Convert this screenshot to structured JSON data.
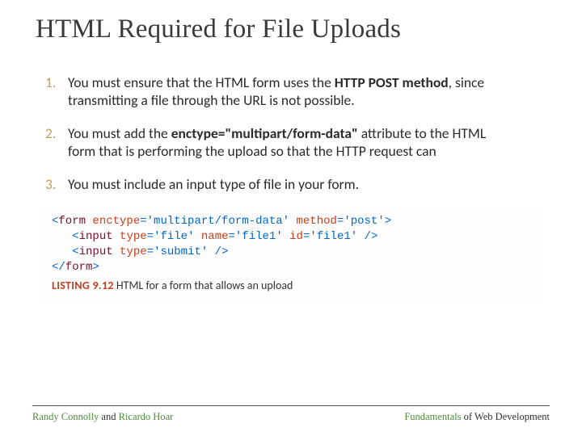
{
  "title": "HTML Required for File Uploads",
  "points": {
    "p1_a": "You must ensure that the HTML form uses the ",
    "p1_b": "HTTP POST method",
    "p1_c": ", since transmitting a file through the URL is not possible.",
    "p2_a": "You must add the ",
    "p2_b": "enctype=\"multipart/form-data\"",
    "p2_c": " attribute to the HTML form that is performing the upload so that the HTTP request can",
    "p3": "You must include an input type of file in your form."
  },
  "code": {
    "l1_open": "<",
    "l1_tag": "form",
    "l1_sp": " ",
    "l1_a1n": "enctype",
    "l1_eq": "=",
    "l1_a1v": "'multipart/form-data'",
    "l1_a2n": "method",
    "l1_a2v": "'post'",
    "l1_close": ">",
    "l2_indent": "   ",
    "l2_open": "<",
    "l2_tag": "input",
    "l2_a1n": "type",
    "l2_a1v": "'file'",
    "l2_a2n": "name",
    "l2_a2v": "'file1'",
    "l2_a3n": "id",
    "l2_a3v": "'file1'",
    "l2_close": " />",
    "l3_indent": "   ",
    "l3_open": "<",
    "l3_tag": "input",
    "l3_a1n": "type",
    "l3_a1v": "'submit'",
    "l3_close": " />",
    "l4_open": "</",
    "l4_tag": "form",
    "l4_close": ">"
  },
  "listing": {
    "num": "LISTING 9.12",
    "desc": " HTML for a form that allows an upload"
  },
  "footer": {
    "left_a": "Randy Connolly",
    "left_mid": " and ",
    "left_b": "Ricardo Hoar",
    "right_a": "Fundamentals",
    "right_b": " of Web Development"
  }
}
